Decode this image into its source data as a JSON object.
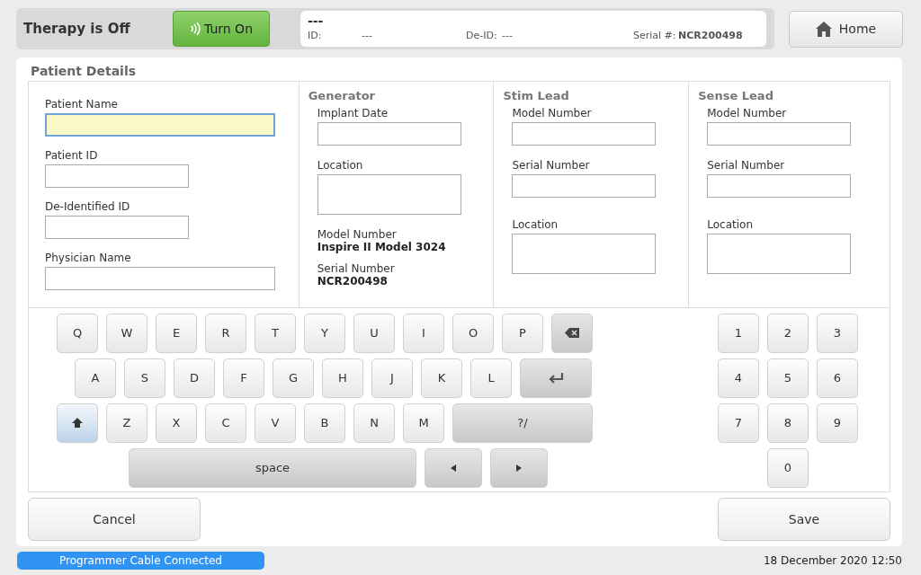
{
  "header": {
    "therapy_status": "Therapy is Off",
    "turn_on_button": "Turn On",
    "patient_info": {
      "name": "---",
      "id_label": "ID:",
      "id_value": "---",
      "deid_label": "De-ID:",
      "deid_value": "---",
      "serial_label": "Serial #:",
      "serial_value": "NCR200498"
    },
    "home_button": "Home"
  },
  "panel_title": "Patient Details",
  "patient_fields": [
    {
      "label": "Patient Name",
      "focused": true,
      "wide": true
    },
    {
      "label": "Patient ID",
      "focused": false,
      "wide": false
    },
    {
      "label": "De-Identified ID",
      "focused": false,
      "wide": false
    },
    {
      "label": "Physician Name",
      "focused": false,
      "wide": true
    }
  ],
  "sections": [
    {
      "title": "Generator",
      "items": [
        {
          "kind": "input",
          "label": "Implant Date"
        },
        {
          "kind": "tall",
          "label": "Location"
        },
        {
          "kind": "info",
          "label": "Model Number",
          "value": "Inspire II Model 3024"
        },
        {
          "kind": "info",
          "label": "Serial Number",
          "value": "NCR200498"
        }
      ]
    },
    {
      "title": "Stim Lead",
      "items": [
        {
          "kind": "input",
          "label": "Model Number"
        },
        {
          "kind": "input",
          "label": "Serial Number"
        },
        {
          "kind": "tall",
          "label": "Location"
        }
      ]
    },
    {
      "title": "Sense Lead",
      "items": [
        {
          "kind": "input",
          "label": "Model Number"
        },
        {
          "kind": "input",
          "label": "Serial Number"
        },
        {
          "kind": "tall",
          "label": "Location"
        }
      ]
    }
  ],
  "keyboard_rows": [
    [
      {
        "kind": "char",
        "label": "Q"
      },
      {
        "kind": "char",
        "label": "W"
      },
      {
        "kind": "char",
        "label": "E"
      },
      {
        "kind": "char",
        "label": "R"
      },
      {
        "kind": "char",
        "label": "T"
      },
      {
        "kind": "char",
        "label": "Y"
      },
      {
        "kind": "char",
        "label": "U"
      },
      {
        "kind": "char",
        "label": "I"
      },
      {
        "kind": "char",
        "label": "O"
      },
      {
        "kind": "char",
        "label": "P"
      },
      {
        "kind": "backspace"
      }
    ],
    [
      {
        "kind": "char",
        "label": "A"
      },
      {
        "kind": "char",
        "label": "S"
      },
      {
        "kind": "char",
        "label": "D"
      },
      {
        "kind": "char",
        "label": "F"
      },
      {
        "kind": "char",
        "label": "G"
      },
      {
        "kind": "char",
        "label": "H"
      },
      {
        "kind": "char",
        "label": "J"
      },
      {
        "kind": "char",
        "label": "K"
      },
      {
        "kind": "char",
        "label": "L"
      },
      {
        "kind": "enter"
      }
    ],
    [
      {
        "kind": "shift",
        "on": true
      },
      {
        "kind": "char",
        "label": "Z"
      },
      {
        "kind": "char",
        "label": "X"
      },
      {
        "kind": "char",
        "label": "C"
      },
      {
        "kind": "char",
        "label": "V"
      },
      {
        "kind": "char",
        "label": "B"
      },
      {
        "kind": "char",
        "label": "N"
      },
      {
        "kind": "char",
        "label": "M"
      },
      {
        "kind": "symbols",
        "label": "?/"
      }
    ],
    [
      {
        "kind": "space",
        "label": "space"
      },
      {
        "kind": "left"
      },
      {
        "kind": "right"
      }
    ]
  ],
  "numpad_rows": [
    [
      "1",
      "2",
      "3"
    ],
    [
      "4",
      "5",
      "6"
    ],
    [
      "7",
      "8",
      "9"
    ],
    [
      "0"
    ]
  ],
  "cancel_button": "Cancel",
  "save_button": "Save",
  "status_bar": {
    "connection": "Programmer Cable Connected",
    "datetime": "18 December 2020 12:50"
  }
}
